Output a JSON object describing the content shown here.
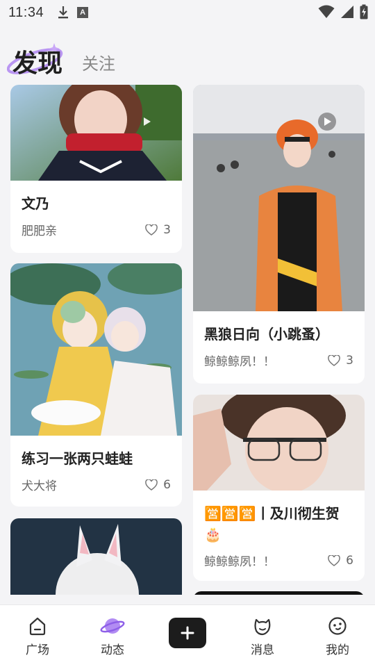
{
  "status_bar": {
    "time": "11:34",
    "icons": [
      "download-icon",
      "font-a-icon",
      "wifi-icon",
      "signal-icon",
      "battery-icon"
    ]
  },
  "header": {
    "tabs": [
      {
        "label": "发现",
        "active": true
      },
      {
        "label": "关注",
        "active": false
      }
    ]
  },
  "feed": {
    "cards": [
      {
        "title": "文乃",
        "author": "肥肥亲",
        "likes": "3",
        "video": true
      },
      {
        "title": "黑狼日向（小跳蚤）",
        "author": "鲸鲸鲸夙！！",
        "likes": "3",
        "video": true
      },
      {
        "title": "练习一张两只蛙蛙",
        "author": "犬大将",
        "likes": "6",
        "video": false
      },
      {
        "title": "🈺🈺🈺丨及川彻生贺🎂",
        "author": "鲸鲸鲸夙！！",
        "likes": "6",
        "video": false
      },
      {
        "title": "",
        "author": "",
        "likes": "",
        "video": false
      },
      {
        "title": "",
        "author": "",
        "likes": "",
        "video": false
      }
    ]
  },
  "bottom_nav": {
    "items": [
      {
        "label": "广场",
        "icon": "home-icon"
      },
      {
        "label": "动态",
        "icon": "planet-icon",
        "active": true
      },
      {
        "label": "",
        "icon": "add-icon"
      },
      {
        "label": "消息",
        "icon": "message-icon"
      },
      {
        "label": "我的",
        "icon": "profile-icon"
      }
    ]
  },
  "colors": {
    "accent": "#a77bf0",
    "background": "#f4f4f6",
    "card": "#ffffff",
    "add_button": "#1c1c1c"
  }
}
